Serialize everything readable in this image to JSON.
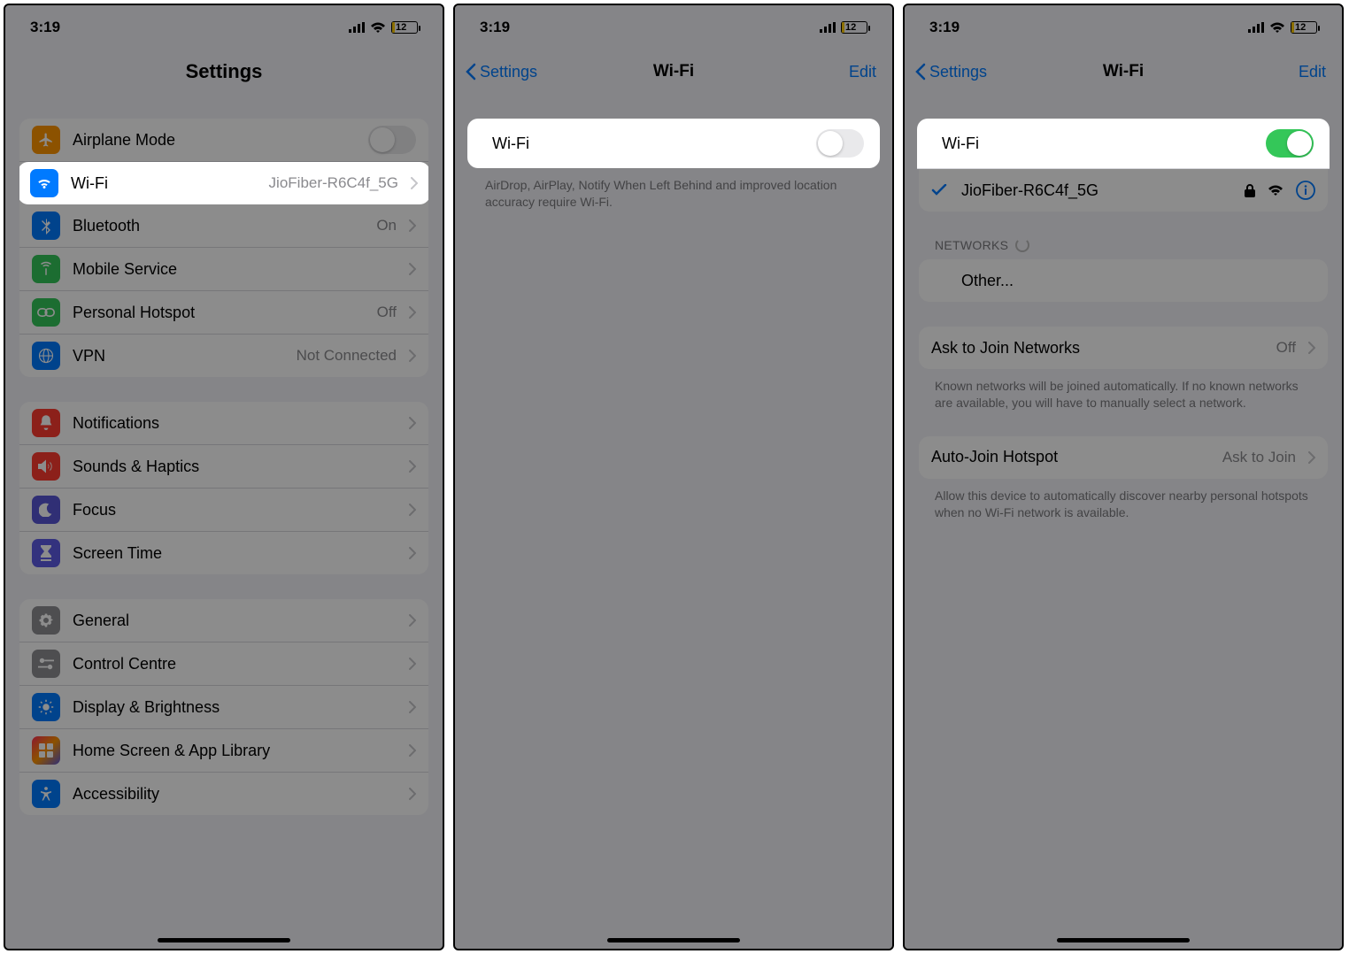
{
  "status": {
    "time": "3:19",
    "battery_pct": "12",
    "battery_fill_pct": 12
  },
  "screen1": {
    "title": "Settings",
    "rows": {
      "airplane": {
        "label": "Airplane Mode"
      },
      "wifi": {
        "label": "Wi-Fi",
        "value": "JioFiber-R6C4f_5G"
      },
      "bluetooth": {
        "label": "Bluetooth",
        "value": "On"
      },
      "mobile": {
        "label": "Mobile Service"
      },
      "hotspot": {
        "label": "Personal Hotspot",
        "value": "Off"
      },
      "vpn": {
        "label": "VPN",
        "value": "Not Connected"
      },
      "notif": {
        "label": "Notifications"
      },
      "sounds": {
        "label": "Sounds & Haptics"
      },
      "focus": {
        "label": "Focus"
      },
      "screentime": {
        "label": "Screen Time"
      },
      "general": {
        "label": "General"
      },
      "control": {
        "label": "Control Centre"
      },
      "display": {
        "label": "Display & Brightness"
      },
      "home": {
        "label": "Home Screen & App Library"
      },
      "access": {
        "label": "Accessibility"
      }
    }
  },
  "screen2": {
    "back": "Settings",
    "title": "Wi-Fi",
    "edit": "Edit",
    "wifi_row": "Wi-Fi",
    "footer": "AirDrop, AirPlay, Notify When Left Behind and improved location accuracy require Wi-Fi."
  },
  "screen3": {
    "back": "Settings",
    "title": "Wi-Fi",
    "edit": "Edit",
    "wifi_row": "Wi-Fi",
    "connected_network": "JioFiber-R6C4f_5G",
    "networks_header": "NETWORKS",
    "other": "Other...",
    "ask_join": {
      "label": "Ask to Join Networks",
      "value": "Off"
    },
    "ask_join_footer": "Known networks will be joined automatically. If no known networks are available, you will have to manually select a network.",
    "auto_hotspot": {
      "label": "Auto-Join Hotspot",
      "value": "Ask to Join"
    },
    "auto_hotspot_footer": "Allow this device to automatically discover nearby personal hotspots when no Wi-Fi network is available."
  }
}
